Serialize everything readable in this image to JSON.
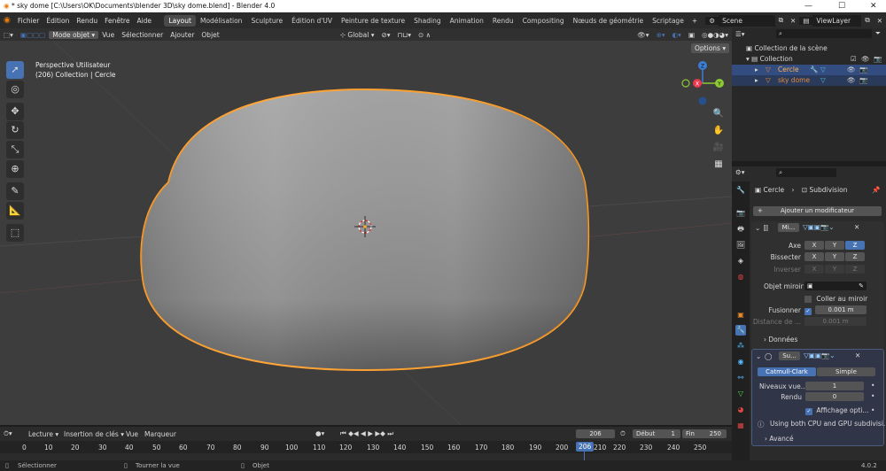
{
  "window": {
    "title": "* sky dome [C:\\Users\\OK\\Documents\\blender 3D\\sky dome.blend] - Blender 4.0",
    "min": "—",
    "max": "☐",
    "close": "✕"
  },
  "menu": [
    "Fichier",
    "Édition",
    "Rendu",
    "Fenêtre",
    "Aide"
  ],
  "workspaces": [
    "Layout",
    "Modélisation",
    "Sculpture",
    "Édition d'UV",
    "Peinture de texture",
    "Shading",
    "Animation",
    "Rendu",
    "Compositing",
    "Nœuds de géométrie",
    "Scriptage"
  ],
  "add_tab": "+",
  "scene": "Scene",
  "view_layer": "ViewLayer",
  "viewport_header": {
    "mode": "Mode objet",
    "items": [
      "Vue",
      "Sélectionner",
      "Ajouter",
      "Objet"
    ],
    "orientation": "Global",
    "options": "Options ▾"
  },
  "viewport": {
    "line1": "Perspective Utilisateur",
    "line2": "(206) Collection | Cercle",
    "gizmo": {
      "z": "Z",
      "x": "X",
      "y": "Y"
    }
  },
  "outliner": {
    "scene_collection": "Collection de la scène",
    "collection": "Collection",
    "items": [
      {
        "name": "Cercle",
        "color": "#e0883a"
      },
      {
        "name": "sky dome",
        "color": "#e0883a"
      }
    ]
  },
  "properties": {
    "breadcrumb_object": "Cercle",
    "breadcrumb_sep": "›",
    "breadcrumb_modifier": "Subdivision",
    "add_modifier": "Ajouter un modificateur",
    "mirror": {
      "name": "Mi...",
      "axis_label": "Axe",
      "bisect_label": "Bissecter",
      "invert_label": "Inverser",
      "axes": [
        "X",
        "Y",
        "Z"
      ],
      "mirror_object_label": "Objet miroir",
      "clip_label": "Coller au miroir",
      "merge_label": "Fusionner",
      "merge_value": "0.001 m",
      "bisect_distance_label": "Distance de ...",
      "bisect_distance_value": "0.001 m",
      "data_label": "Données"
    },
    "subdivision": {
      "name": "Su...",
      "tab_catmull": "Catmull-Clark",
      "tab_simple": "Simple",
      "levels_label": "Niveaux vue...",
      "levels_value": "1",
      "render_label": "Rendu",
      "render_value": "0",
      "optimal_label": "Affichage opti...",
      "info": "Using both CPU and GPU subdivisi...",
      "advanced_label": "Avancé"
    }
  },
  "timeline": {
    "playback": "Lecture",
    "keying": "Insertion de clés",
    "view": "Vue",
    "marker": "Marqueur",
    "current_frame": "206",
    "start_label": "Début",
    "start_value": "1",
    "end_label": "Fin",
    "end_value": "250",
    "ticks": [
      "0",
      "10",
      "20",
      "30",
      "40",
      "50",
      "60",
      "70",
      "80",
      "90",
      "100",
      "110",
      "120",
      "130",
      "140",
      "150",
      "160",
      "170",
      "180",
      "190",
      "200",
      "206",
      "210",
      "220",
      "230",
      "240",
      "250"
    ]
  },
  "status": {
    "select": "Sélectionner",
    "rotate": "Tourner la vue",
    "object": "Objet",
    "version": "4.0.2"
  },
  "colors": {
    "accent": "#4772b3",
    "selection_outline": "#ffa232",
    "axis_x": "#e8394e",
    "axis_y": "#8cc934",
    "axis_z": "#3a7fd5"
  }
}
